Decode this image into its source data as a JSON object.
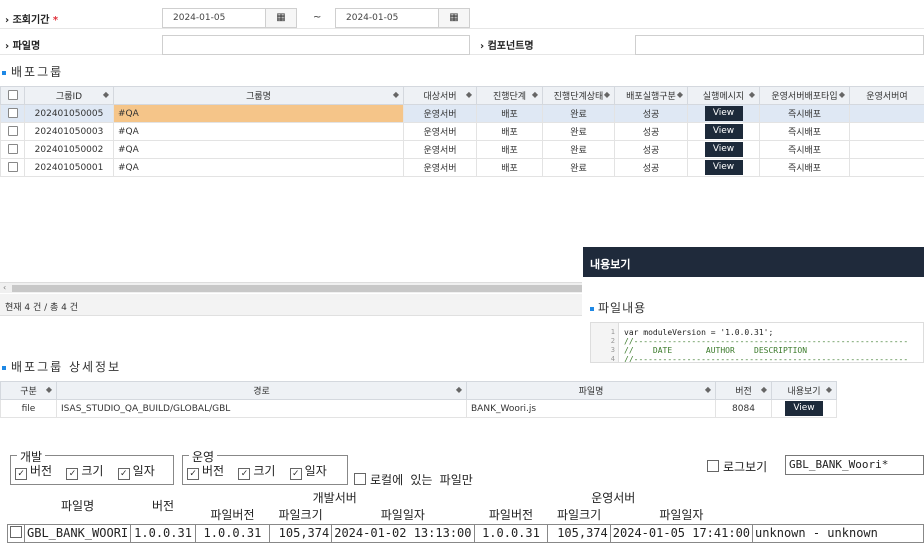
{
  "search": {
    "period_label": "조회기간",
    "required_mark": "*",
    "date_from": "2024-01-05",
    "date_to": "2024-01-05",
    "tilde": "~",
    "filename_label": "파일명",
    "component_label": "컴포넌트명"
  },
  "group_section": {
    "title": "배포그룹",
    "columns": [
      "그룹ID",
      "그룹명",
      "대상서버",
      "진행단계",
      "진행단계상태",
      "배포실행구분",
      "실행메시지",
      "운영서버배포타입",
      "운영서버여"
    ],
    "rows": [
      {
        "id": "202401050005",
        "name": "#QA",
        "server": "운영서버",
        "stage": "배포",
        "stage_status": "완료",
        "exec_type": "성공",
        "msg": "View",
        "deploy_type": "즉시배포"
      },
      {
        "id": "202401050003",
        "name": "#QA",
        "server": "운영서버",
        "stage": "배포",
        "stage_status": "완료",
        "exec_type": "성공",
        "msg": "View",
        "deploy_type": "즉시배포"
      },
      {
        "id": "202401050002",
        "name": "#QA",
        "server": "운영서버",
        "stage": "배포",
        "stage_status": "완료",
        "exec_type": "성공",
        "msg": "View",
        "deploy_type": "즉시배포"
      },
      {
        "id": "202401050001",
        "name": "#QA",
        "server": "운영서버",
        "stage": "배포",
        "stage_status": "완료",
        "exec_type": "성공",
        "msg": "View",
        "deploy_type": "즉시배포"
      }
    ],
    "status": "현재 4 건 / 총 4 건"
  },
  "viewer": {
    "title": "내용보기",
    "sub_title": "파일내용",
    "code_lines": [
      {
        "n": "1",
        "text": "var moduleVersion = '1.0.0.31';"
      },
      {
        "n": "2",
        "text": "//---------------------------------------------------------"
      },
      {
        "n": "3",
        "text": "//    DATE       AUTHOR    DESCRIPTION"
      },
      {
        "n": "4",
        "text": "//---------------------------------------------------------"
      }
    ]
  },
  "detail_section": {
    "title": "배포그룹 상세정보",
    "columns": [
      "구분",
      "경로",
      "파일명",
      "버전",
      "내용보기"
    ],
    "rows": [
      {
        "type": "file",
        "path": "ISAS_STUDIO_QA_BUILD/GLOBAL/GBL",
        "filename": "BANK_Woori.js",
        "version": "8084",
        "view": "View"
      }
    ]
  },
  "legacy": {
    "dev_legend": "개발",
    "ops_legend": "운영",
    "opt_version": "버전",
    "opt_size": "크기",
    "opt_date": "일자",
    "local_only": "로컬에 있는 파일만",
    "log_view": "로그보기",
    "log_value": "GBL_BANK_Woori*",
    "header": {
      "filename": "파일명",
      "version": "버전",
      "dev_server": "개발서버",
      "ops_server": "운영서버",
      "file_version": "파일버전",
      "file_size": "파일크기",
      "file_date": "파일일자"
    },
    "row": {
      "filename": "GBL_BANK_WOORI",
      "version": "1.0.0.31",
      "dev_version": "1.0.0.31",
      "dev_size": "105,374",
      "dev_date": "2024-01-02 13:13:00",
      "ops_version": "1.0.0.31",
      "ops_size": "105,374",
      "ops_date": "2024-01-05 17:41:00",
      "user": "unknown - unknown"
    }
  }
}
